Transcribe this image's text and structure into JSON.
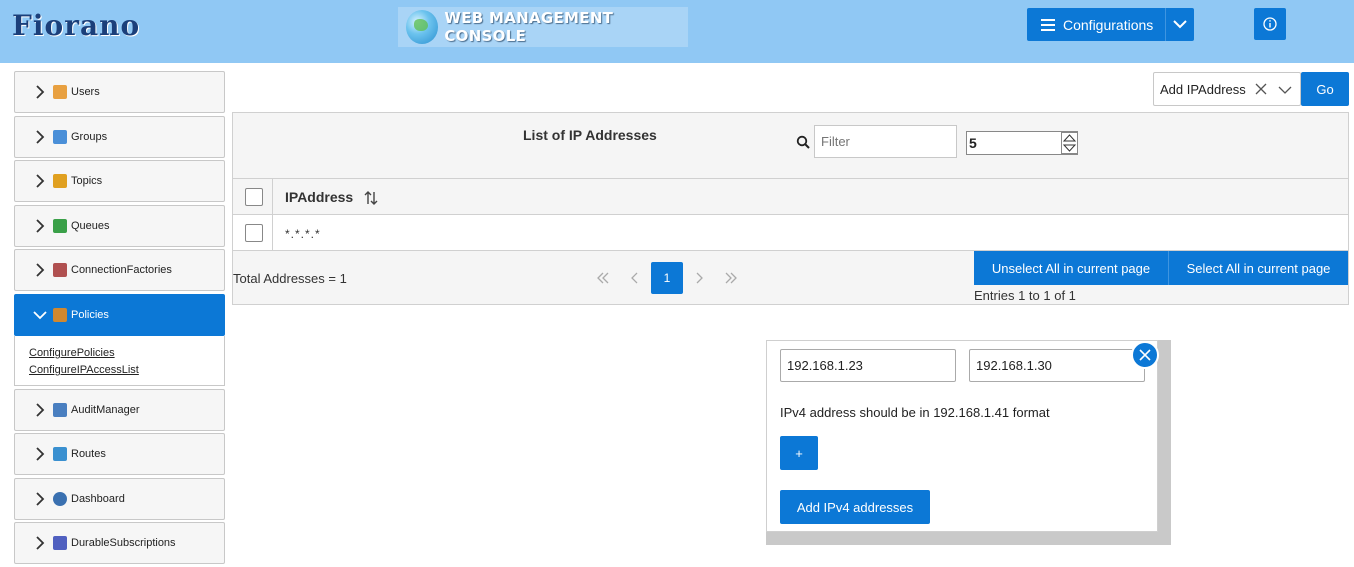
{
  "header": {
    "logo": "Fiorano",
    "console_title": "WEB MANAGEMENT CONSOLE",
    "configurations_label": "Configurations",
    "accent": "#0c78d6",
    "bg": "#90c8f4"
  },
  "sidebar": {
    "items": [
      {
        "label": "Users",
        "icon": "user-icon",
        "color": "#e8a040"
      },
      {
        "label": "Groups",
        "icon": "group-icon",
        "color": "#4a8fd8"
      },
      {
        "label": "Topics",
        "icon": "topic-icon",
        "color": "#e0a020"
      },
      {
        "label": "Queues",
        "icon": "queue-icon",
        "color": "#3aa048"
      },
      {
        "label": "ConnectionFactories",
        "icon": "connection-factory-icon",
        "color": "#b05050"
      },
      {
        "label": "Policies",
        "icon": "policy-icon",
        "color": "#d08830",
        "active": true
      },
      {
        "label": "AuditManager",
        "icon": "audit-icon",
        "color": "#4a7fc0"
      },
      {
        "label": "Routes",
        "icon": "route-icon",
        "color": "#3a90d0"
      },
      {
        "label": "Dashboard",
        "icon": "dashboard-icon",
        "color": "#3a70b0"
      },
      {
        "label": "DurableSubscriptions",
        "icon": "durable-subscription-icon",
        "color": "#5060c0"
      }
    ],
    "policies_sub": [
      "ConfigurePolicies",
      "ConfigureIPAccessList"
    ]
  },
  "top": {
    "select_value": "Add IPAddress",
    "go_label": "Go"
  },
  "table": {
    "title": "List of IP Addresses",
    "filter_placeholder": "Filter",
    "rows_per_page": "5",
    "column_header": "IPAddress",
    "rows": [
      "*.*.*.*"
    ],
    "total": "Total Addresses = 1",
    "current_page": "1",
    "unselect_label": "Unselect All in current page",
    "select_label": "Select All in current page",
    "entries": "Entries 1 to 1 of 1"
  },
  "popup": {
    "start_ip": "192.168.1.23",
    "end_ip": "192.168.1.30",
    "hint": "IPv4 address should be in 192.168.1.41 format",
    "plus_label": "+",
    "add_label": "Add IPv4 addresses"
  }
}
